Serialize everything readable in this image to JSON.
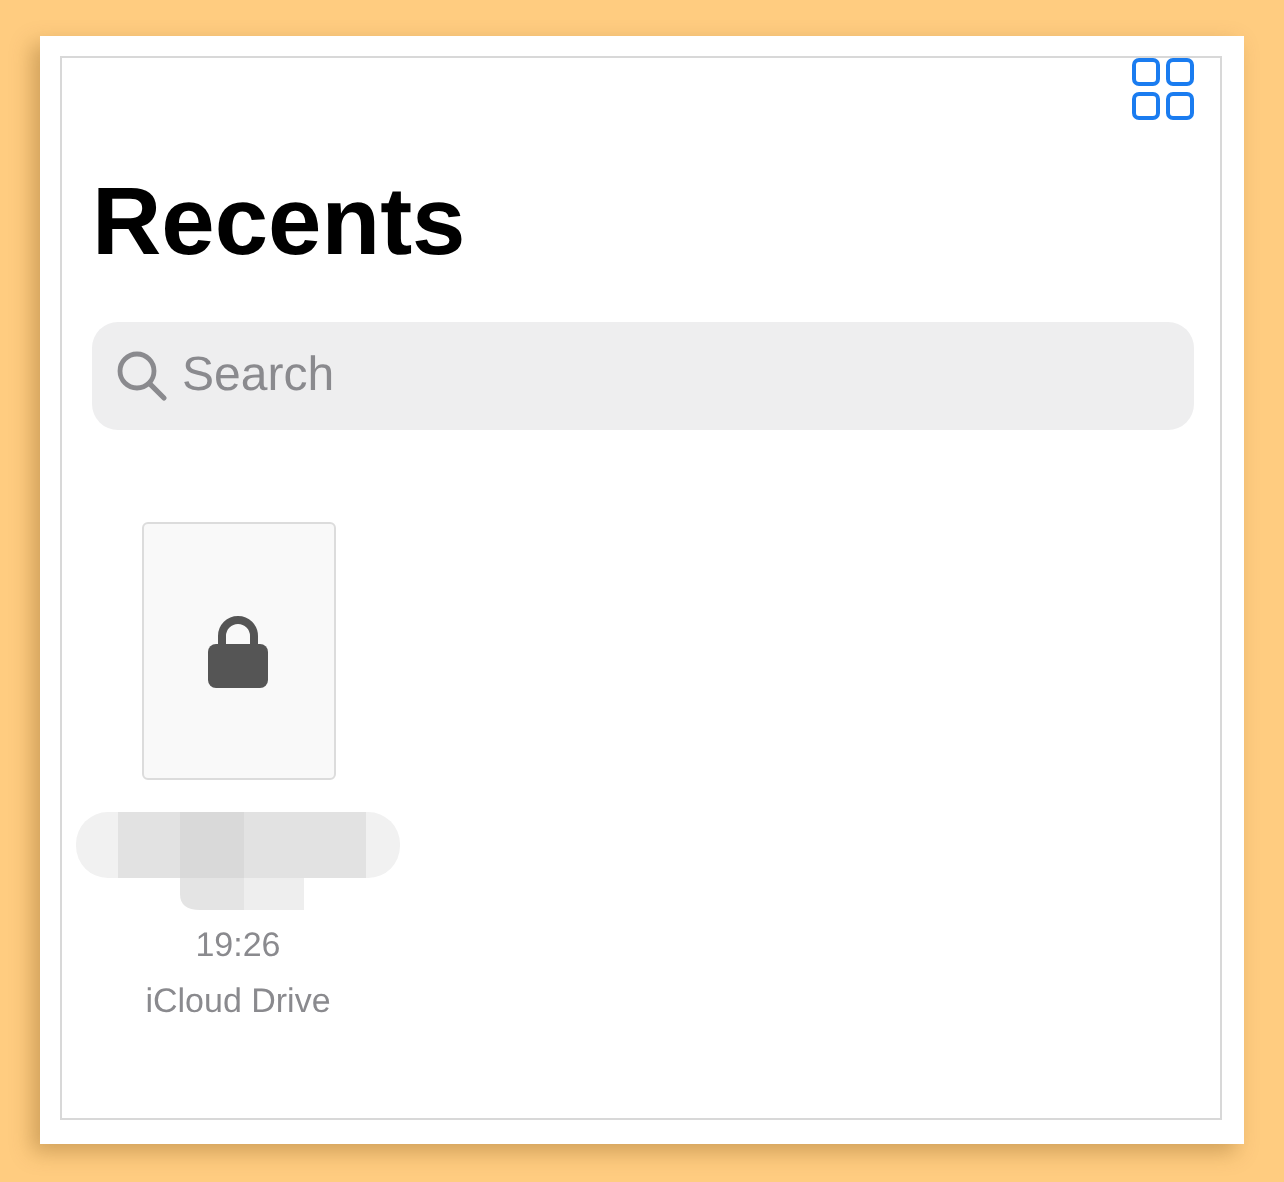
{
  "title": "Recents",
  "search": {
    "placeholder": "Search"
  },
  "files": [
    {
      "kind": "locked",
      "time": "19:26",
      "location": "iCloud Drive"
    }
  ]
}
